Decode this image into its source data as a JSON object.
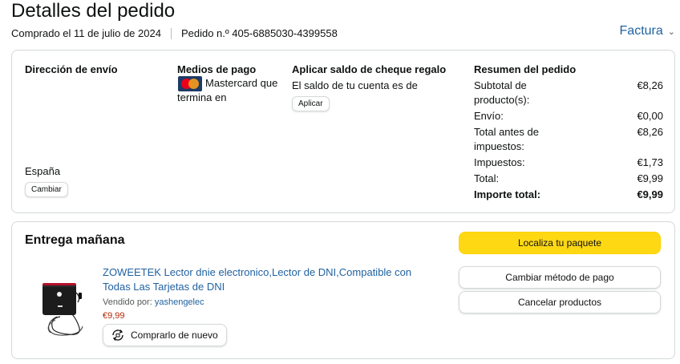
{
  "page": {
    "title": "Detalles del pedido",
    "order_date": "Comprado el 11 de julio de 2024",
    "order_number": "Pedido n.º 405-6885030-4399558",
    "invoice_label": "Factura",
    "invoice_icon": "chevron-down-icon"
  },
  "shipping": {
    "heading": "Dirección de envío",
    "country": "España",
    "change_label": "Cambiar"
  },
  "payment": {
    "heading": "Medios de pago",
    "method_text": "Mastercard que termina en",
    "card_icon": "mastercard-icon"
  },
  "gift": {
    "heading": "Aplicar saldo de cheque regalo",
    "text": "El saldo de tu cuenta es de",
    "apply_label": "Aplicar"
  },
  "summary": {
    "heading": "Resumen del pedido",
    "rows": [
      {
        "label": "Subtotal de producto(s):",
        "value": "€8,26"
      },
      {
        "label": "Envío:",
        "value": "€0,00"
      },
      {
        "label": "Total antes de impuestos:",
        "value": "€8,26"
      },
      {
        "label": "Impuestos:",
        "value": "€1,73"
      },
      {
        "label": "Total:",
        "value": "€9,99"
      },
      {
        "label": "Importe total:",
        "value": "€9,99"
      }
    ]
  },
  "delivery": {
    "title": "Entrega mañana",
    "track_label": "Localiza tu paquete",
    "change_payment_label": "Cambiar método de pago",
    "cancel_label": "Cancelar productos",
    "product": {
      "title": "ZOWEETEK Lector dnie electronico,Lector de DNI,Compatible con Todas Las Tarjetas de DNI",
      "seller_prefix": "Vendido por:",
      "seller_name": "yashengelec",
      "price": "€9,99",
      "buy_again_label": "Comprarlo de nuevo",
      "buy_again_icon": "buy-again-icon"
    }
  },
  "colors": {
    "link": "#2162a1",
    "price": "#b12704",
    "primary_button": "#ffd814",
    "border": "#d5d9d9"
  }
}
